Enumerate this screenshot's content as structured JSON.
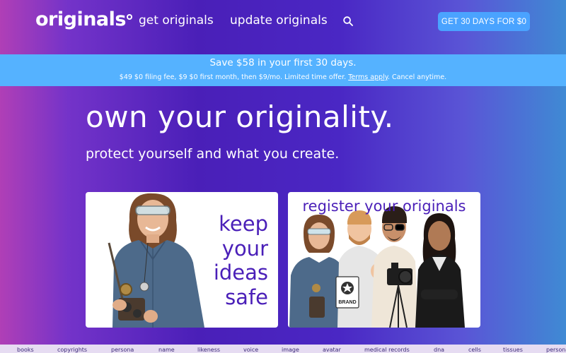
{
  "brand": {
    "name": "originals"
  },
  "nav": {
    "get_label": "get originals",
    "update_label": "update originals",
    "cta_label": "GET 30 DAYS FOR $0"
  },
  "promo": {
    "title": "Save $58 in your first 30 days.",
    "sub_prefix": "$49 $0 filing fee, $9 $0 first month, then $9/mo. Limited time offer.",
    "terms_link": "Terms apply",
    "sub_suffix": ". Cancel anytime."
  },
  "hero": {
    "title": "own your originality.",
    "subtitle": "protect yourself and what you create."
  },
  "cards": [
    {
      "line1": "keep",
      "line2": "your",
      "line3": "ideas",
      "line4": "safe"
    },
    {
      "caption": "register your originals",
      "badge": "BRAND"
    }
  ],
  "tags": [
    "books",
    "copyrights",
    "persona",
    "name",
    "likeness",
    "voice",
    "image",
    "avatar",
    "medical records",
    "dna",
    "cells",
    "tissues",
    "persona"
  ],
  "colors": {
    "accent": "#4aa3ff",
    "promo_bg": "#55b2ff",
    "card_text": "#4a1fb8",
    "tag_bar": "#e6dcf2"
  },
  "icons": {
    "search": "search-icon",
    "logo_mark": "ring-icon"
  }
}
